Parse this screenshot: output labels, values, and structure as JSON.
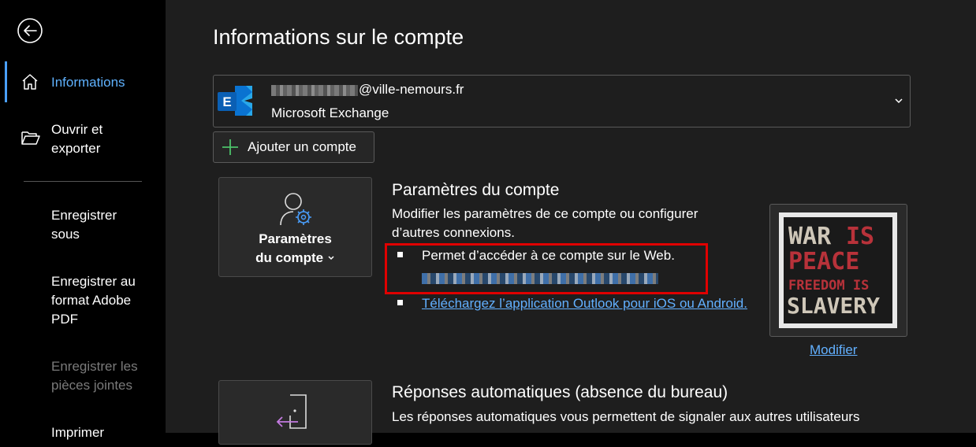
{
  "sidebar": {
    "items": [
      {
        "label": "Informations",
        "icon": "home-icon"
      },
      {
        "label": "Ouvrir et exporter",
        "icon": "folder-open-icon"
      },
      {
        "label": "Enregistrer sous"
      },
      {
        "label": "Enregistrer au format Adobe PDF"
      },
      {
        "label": "Enregistrer les pièces jointes"
      },
      {
        "label": "Imprimer"
      }
    ]
  },
  "page": {
    "title": "Informations sur le compte"
  },
  "account": {
    "email_visible": "@ville-nemours.fr",
    "type": "Microsoft Exchange",
    "icon": "exchange-icon"
  },
  "add_account": {
    "label": "Ajouter un compte"
  },
  "account_settings": {
    "tile_label_line1": "Paramètres",
    "tile_label_line2": "du compte",
    "title": "Paramètres du compte",
    "description": "Modifier les paramètres de ce compte ou configurer d’autres connexions.",
    "bullet1": "Permet d’accéder à ce compte sur le Web.",
    "bullet2": "Téléchargez l’application Outlook pour iOS ou Android."
  },
  "profile_picture": {
    "modify_label": "Modifier",
    "image_text": [
      "WAR",
      "IS",
      "PEACE",
      "FREEDOM IS",
      "SLAVERY"
    ]
  },
  "auto_replies": {
    "title": "Réponses automatiques (absence du bureau)",
    "description": "Les réponses automatiques vous permettent de signaler aux autres utilisateurs"
  },
  "colors": {
    "accent": "#5fb2ff",
    "highlight": "#e00000",
    "exchange": "#0a73d1"
  }
}
